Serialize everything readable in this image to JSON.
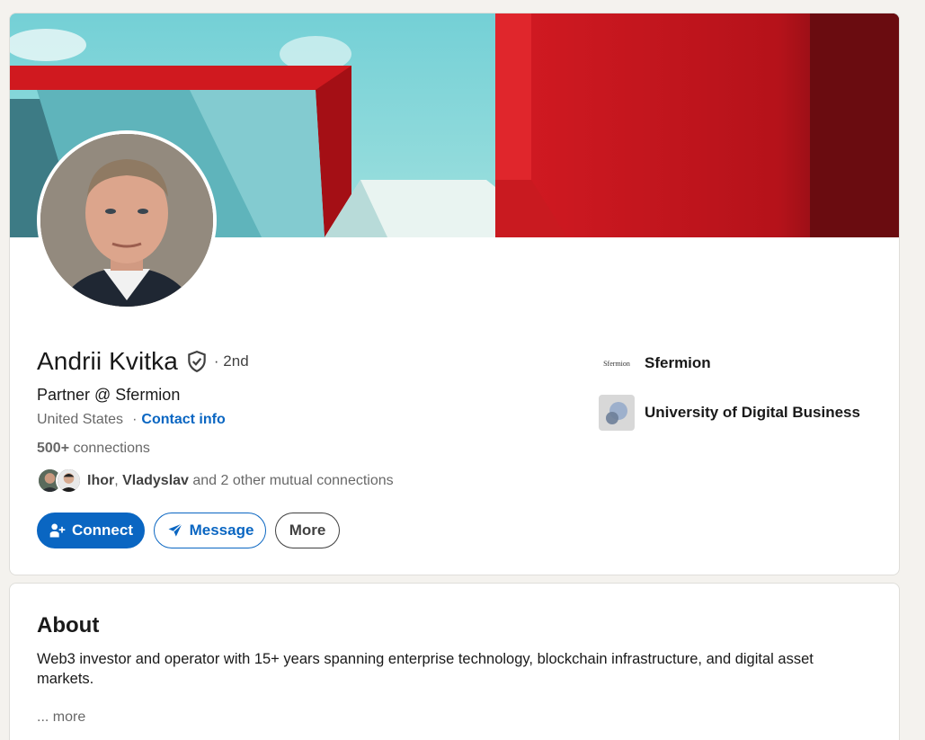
{
  "profile": {
    "name": "Andrii Kvitka",
    "degree": "· 2nd",
    "headline": "Partner @ Sfermion",
    "location": "United States",
    "location_separator": "·",
    "contact_info": "Contact info",
    "connections_count": "500+",
    "connections_label": "connections",
    "mutual": {
      "name1": "Ihor",
      "separator": ", ",
      "name2": "Vladyslav",
      "rest": " and 2 other mutual connections"
    },
    "verified_icon": "shield-check-icon"
  },
  "actions": {
    "connect_label": "Connect",
    "message_label": "Message",
    "more_label": "More"
  },
  "organizations": [
    {
      "logo_text": "Sfermion",
      "name": "Sfermion"
    },
    {
      "logo_text": "",
      "name": "University of Digital Business"
    }
  ],
  "about": {
    "title": "About",
    "text": "Web3 investor and operator with 15+ years spanning enterprise technology, blockchain infrastructure, and digital asset markets.",
    "more": "... more"
  },
  "colors": {
    "brand_blue": "#0a66c2",
    "page_bg": "#f4f2ee"
  }
}
